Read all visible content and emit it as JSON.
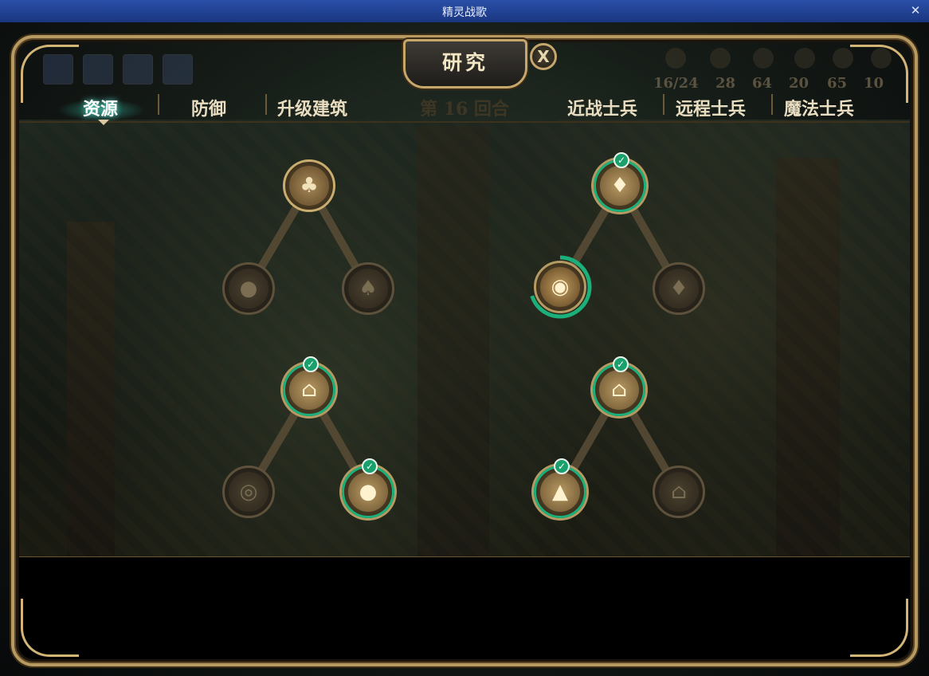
{
  "window": {
    "title": "精灵战歌",
    "close_label": "✕"
  },
  "panel": {
    "title": "研究",
    "close_label": "X"
  },
  "tabs": [
    {
      "label": "资源",
      "active": true
    },
    {
      "label": "防御",
      "active": false
    },
    {
      "label": "升级建筑",
      "active": false
    },
    {
      "label": "近战士兵",
      "active": false
    },
    {
      "label": "远程士兵",
      "active": false
    },
    {
      "label": "魔法士兵",
      "active": false
    }
  ],
  "round_label": "第 16 回合",
  "counters": [
    "16/24",
    "28",
    "64",
    "20",
    "65",
    "10"
  ],
  "research_tree": {
    "left": [
      {
        "icon": "tree-icon",
        "glyph": "♣",
        "state": "available"
      },
      {
        "icon": "apple-icon",
        "glyph": "●",
        "state": "locked"
      },
      {
        "icon": "tree-upgrade-icon",
        "glyph": "♠",
        "state": "locked"
      },
      {
        "icon": "house-upgrade-icon",
        "glyph": "⌂",
        "state": "done"
      },
      {
        "icon": "coin-stack-icon",
        "glyph": "◎",
        "state": "locked"
      },
      {
        "icon": "apple-upgrade-icon",
        "glyph": "●",
        "state": "done"
      }
    ],
    "right": [
      {
        "icon": "crystal-icon",
        "glyph": "♦",
        "state": "done"
      },
      {
        "icon": "magic-orb-icon",
        "glyph": "◉",
        "state": "in-progress"
      },
      {
        "icon": "crystal-upgrade-icon",
        "glyph": "♦",
        "state": "locked"
      },
      {
        "icon": "house-upgrade-icon",
        "glyph": "⌂",
        "state": "done"
      },
      {
        "icon": "mountain-icon",
        "glyph": "▲",
        "state": "done"
      },
      {
        "icon": "barracks-icon",
        "glyph": "⌂",
        "state": "locked"
      }
    ],
    "progress_fraction": 0.7
  },
  "colors": {
    "gold": "#c5a66b",
    "done": "#1bb07a",
    "title_bar": "#2a4fa8"
  }
}
